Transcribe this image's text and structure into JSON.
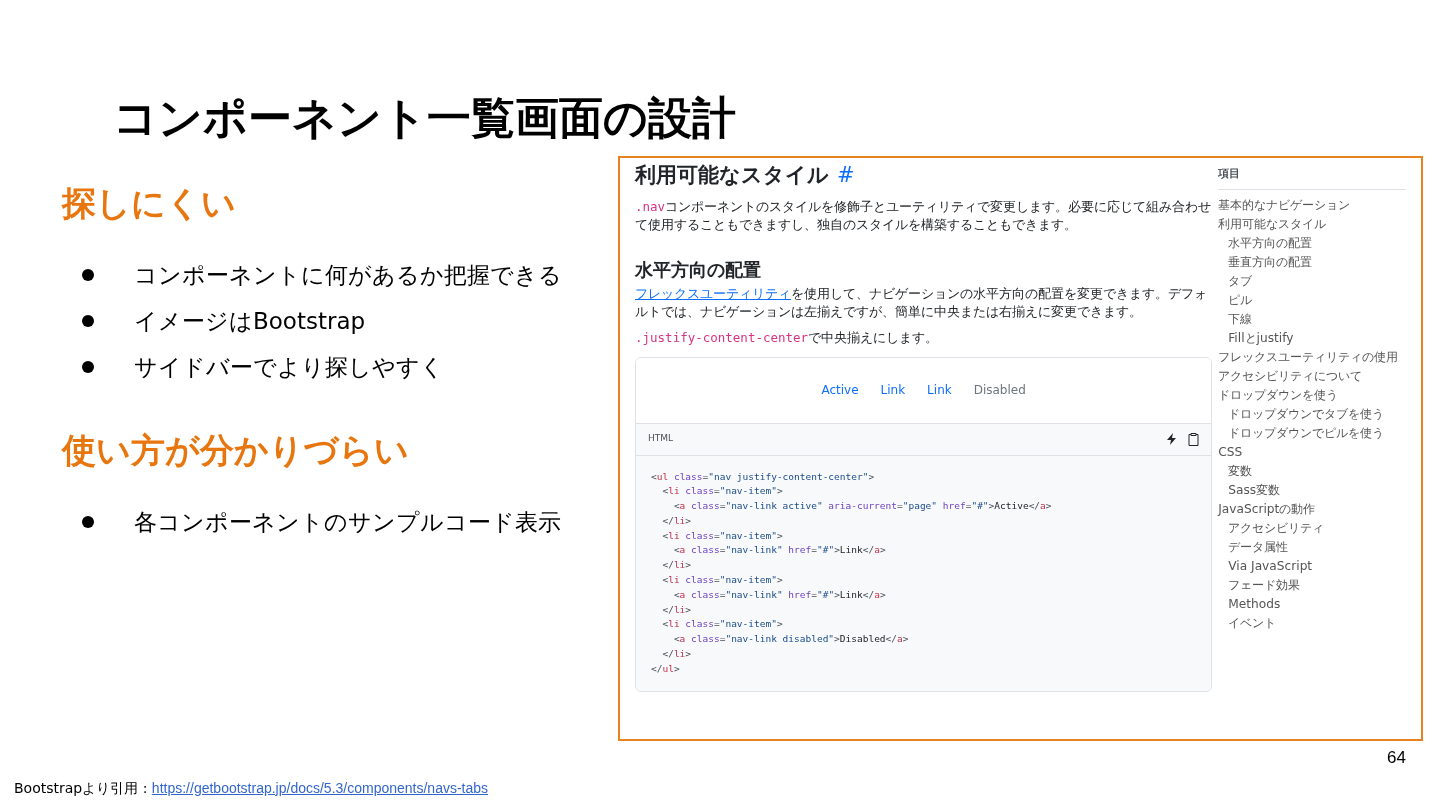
{
  "slide": {
    "title": "コンポーネント一覧画面の設計",
    "page_number": "64",
    "sections": [
      {
        "heading": "探しにくい",
        "bullets": [
          "コンポーネントに何があるか把握できる",
          "イメージはBootstrap",
          "サイドバーでより探しやすく"
        ]
      },
      {
        "heading": "使い方が分かりづらい",
        "bullets": [
          "各コンポーネントのサンプルコード表示"
        ]
      }
    ],
    "citation": {
      "label": "Bootstrapより引用 : ",
      "url": "https://getbootstrap.jp/docs/5.3/components/navs-tabs"
    }
  },
  "screenshot": {
    "heading": "利用可能なスタイル",
    "anchor": "#",
    "intro": {
      "code": ".nav",
      "text": "コンポーネントのスタイルを修飾子とユーティリティで変更します。必要に応じて組み合わせて使用することもできますし、独自のスタイルを構築することもできます。"
    },
    "subheading": "水平方向の配置",
    "paragraph": {
      "link": "フレックスユーティリティ",
      "text": "を使用して、ナビゲーションの水平方向の配置を変更できます。デフォルトでは、ナビゲーションは左揃えですが、簡単に中央または右揃えに変更できます。"
    },
    "note": {
      "code": ".justify-content-center",
      "text": "で中央揃えにします。"
    },
    "nav_demo": [
      {
        "label": "Active",
        "disabled": false
      },
      {
        "label": "Link",
        "disabled": false
      },
      {
        "label": "Link",
        "disabled": false
      },
      {
        "label": "Disabled",
        "disabled": true
      }
    ],
    "code_label": "HTML",
    "code_lines": [
      [
        {
          "kind": "punct",
          "text": "<"
        },
        {
          "kind": "tag",
          "text": "ul"
        },
        {
          "kind": "attr",
          "text": " class"
        },
        {
          "kind": "punct",
          "text": "="
        },
        {
          "kind": "string",
          "text": "\"nav justify-content-center\""
        },
        {
          "kind": "punct",
          "text": ">"
        }
      ],
      [
        {
          "kind": "punct",
          "text": "  <"
        },
        {
          "kind": "tag",
          "text": "li"
        },
        {
          "kind": "attr",
          "text": " class"
        },
        {
          "kind": "punct",
          "text": "="
        },
        {
          "kind": "string",
          "text": "\"nav-item\""
        },
        {
          "kind": "punct",
          "text": ">"
        }
      ],
      [
        {
          "kind": "punct",
          "text": "    <"
        },
        {
          "kind": "tag",
          "text": "a"
        },
        {
          "kind": "attr",
          "text": " class"
        },
        {
          "kind": "punct",
          "text": "="
        },
        {
          "kind": "string",
          "text": "\"nav-link active\""
        },
        {
          "kind": "attr",
          "text": " aria-current"
        },
        {
          "kind": "punct",
          "text": "="
        },
        {
          "kind": "string",
          "text": "\"page\""
        },
        {
          "kind": "attr",
          "text": " href"
        },
        {
          "kind": "punct",
          "text": "="
        },
        {
          "kind": "string",
          "text": "\"#\""
        },
        {
          "kind": "punct",
          "text": ">"
        },
        {
          "kind": "text",
          "text": "Active"
        },
        {
          "kind": "punct",
          "text": "</"
        },
        {
          "kind": "tag",
          "text": "a"
        },
        {
          "kind": "punct",
          "text": ">"
        }
      ],
      [
        {
          "kind": "punct",
          "text": "  </"
        },
        {
          "kind": "tag",
          "text": "li"
        },
        {
          "kind": "punct",
          "text": ">"
        }
      ],
      [
        {
          "kind": "punct",
          "text": "  <"
        },
        {
          "kind": "tag",
          "text": "li"
        },
        {
          "kind": "attr",
          "text": " class"
        },
        {
          "kind": "punct",
          "text": "="
        },
        {
          "kind": "string",
          "text": "\"nav-item\""
        },
        {
          "kind": "punct",
          "text": ">"
        }
      ],
      [
        {
          "kind": "punct",
          "text": "    <"
        },
        {
          "kind": "tag",
          "text": "a"
        },
        {
          "kind": "attr",
          "text": " class"
        },
        {
          "kind": "punct",
          "text": "="
        },
        {
          "kind": "string",
          "text": "\"nav-link\""
        },
        {
          "kind": "attr",
          "text": " href"
        },
        {
          "kind": "punct",
          "text": "="
        },
        {
          "kind": "string",
          "text": "\"#\""
        },
        {
          "kind": "punct",
          "text": ">"
        },
        {
          "kind": "text",
          "text": "Link"
        },
        {
          "kind": "punct",
          "text": "</"
        },
        {
          "kind": "tag",
          "text": "a"
        },
        {
          "kind": "punct",
          "text": ">"
        }
      ],
      [
        {
          "kind": "punct",
          "text": "  </"
        },
        {
          "kind": "tag",
          "text": "li"
        },
        {
          "kind": "punct",
          "text": ">"
        }
      ],
      [
        {
          "kind": "punct",
          "text": "  <"
        },
        {
          "kind": "tag",
          "text": "li"
        },
        {
          "kind": "attr",
          "text": " class"
        },
        {
          "kind": "punct",
          "text": "="
        },
        {
          "kind": "string",
          "text": "\"nav-item\""
        },
        {
          "kind": "punct",
          "text": ">"
        }
      ],
      [
        {
          "kind": "punct",
          "text": "    <"
        },
        {
          "kind": "tag",
          "text": "a"
        },
        {
          "kind": "attr",
          "text": " class"
        },
        {
          "kind": "punct",
          "text": "="
        },
        {
          "kind": "string",
          "text": "\"nav-link\""
        },
        {
          "kind": "attr",
          "text": " href"
        },
        {
          "kind": "punct",
          "text": "="
        },
        {
          "kind": "string",
          "text": "\"#\""
        },
        {
          "kind": "punct",
          "text": ">"
        },
        {
          "kind": "text",
          "text": "Link"
        },
        {
          "kind": "punct",
          "text": "</"
        },
        {
          "kind": "tag",
          "text": "a"
        },
        {
          "kind": "punct",
          "text": ">"
        }
      ],
      [
        {
          "kind": "punct",
          "text": "  </"
        },
        {
          "kind": "tag",
          "text": "li"
        },
        {
          "kind": "punct",
          "text": ">"
        }
      ],
      [
        {
          "kind": "punct",
          "text": "  <"
        },
        {
          "kind": "tag",
          "text": "li"
        },
        {
          "kind": "attr",
          "text": " class"
        },
        {
          "kind": "punct",
          "text": "="
        },
        {
          "kind": "string",
          "text": "\"nav-item\""
        },
        {
          "kind": "punct",
          "text": ">"
        }
      ],
      [
        {
          "kind": "punct",
          "text": "    <"
        },
        {
          "kind": "tag",
          "text": "a"
        },
        {
          "kind": "attr",
          "text": " class"
        },
        {
          "kind": "punct",
          "text": "="
        },
        {
          "kind": "string",
          "text": "\"nav-link disabled\""
        },
        {
          "kind": "punct",
          "text": ">"
        },
        {
          "kind": "text",
          "text": "Disabled"
        },
        {
          "kind": "punct",
          "text": "</"
        },
        {
          "kind": "tag",
          "text": "a"
        },
        {
          "kind": "punct",
          "text": ">"
        }
      ],
      [
        {
          "kind": "punct",
          "text": "  </"
        },
        {
          "kind": "tag",
          "text": "li"
        },
        {
          "kind": "punct",
          "text": ">"
        }
      ],
      [
        {
          "kind": "punct",
          "text": "</"
        },
        {
          "kind": "tag",
          "text": "ul"
        },
        {
          "kind": "punct",
          "text": ">"
        }
      ]
    ],
    "toc": {
      "title": "項目",
      "items": [
        {
          "label": "基本的なナビゲーション"
        },
        {
          "label": "利用可能なスタイル",
          "children": [
            {
              "label": "水平方向の配置"
            },
            {
              "label": "垂直方向の配置"
            },
            {
              "label": "タブ"
            },
            {
              "label": "ピル"
            },
            {
              "label": "下線"
            },
            {
              "label": "Fillとjustify"
            }
          ]
        },
        {
          "label": "フレックスユーティリティの使用"
        },
        {
          "label": "アクセシビリティについて"
        },
        {
          "label": "ドロップダウンを使う",
          "children": [
            {
              "label": "ドロップダウンでタブを使う"
            },
            {
              "label": "ドロップダウンでピルを使う"
            }
          ]
        },
        {
          "label": "CSS",
          "children": [
            {
              "label": "変数"
            },
            {
              "label": "Sass変数"
            }
          ]
        },
        {
          "label": "JavaScriptの動作",
          "children": [
            {
              "label": "アクセシビリティ"
            },
            {
              "label": "データ属性"
            },
            {
              "label": "Via JavaScript"
            },
            {
              "label": "フェード効果"
            },
            {
              "label": "Methods"
            },
            {
              "label": "イベント"
            }
          ]
        }
      ]
    }
  }
}
